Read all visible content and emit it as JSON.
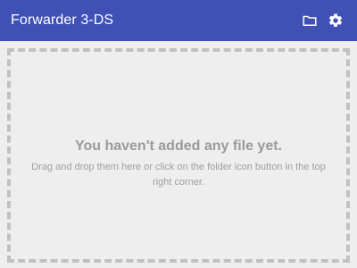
{
  "app": {
    "title": "Forwarder 3-DS"
  },
  "toolbar": {
    "icons": [
      "folder-icon",
      "gear-icon"
    ],
    "accent_color": "#3f51b5"
  },
  "dropzone": {
    "heading": "You haven't added any file yet.",
    "instructions": "Drag and drop them here or click on the folder icon button in the top right corner."
  }
}
